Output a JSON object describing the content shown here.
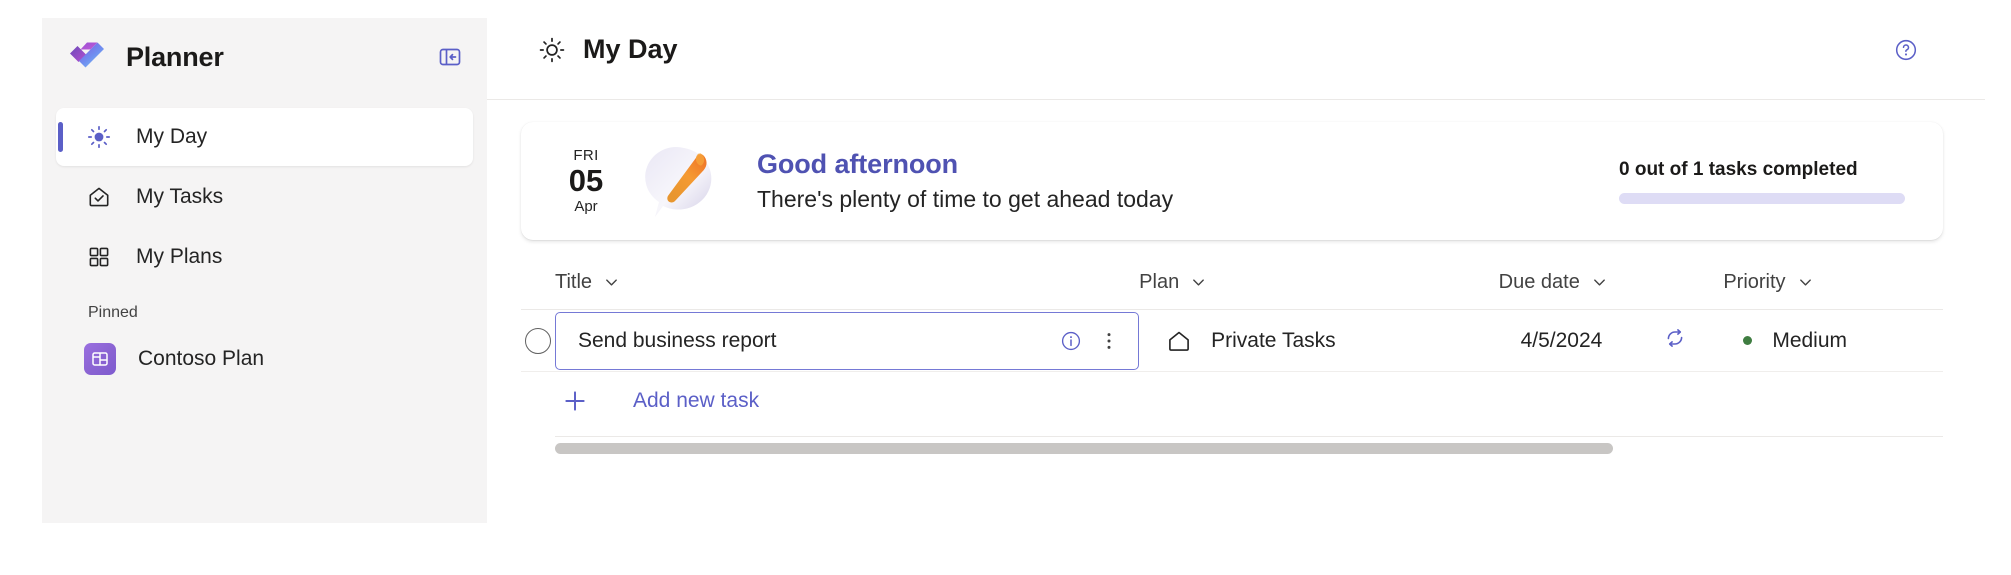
{
  "brand": {
    "name": "Planner",
    "logo_icon": "planner-logo-icon",
    "collapse_icon": "collapse-sidebar-icon"
  },
  "sidebar": {
    "items": [
      {
        "label": "My Day",
        "icon": "sun-icon",
        "active": true
      },
      {
        "label": "My Tasks",
        "icon": "home-check-icon",
        "active": false
      },
      {
        "label": "My Plans",
        "icon": "grid-icon",
        "active": false
      }
    ],
    "section_label": "Pinned",
    "pinned": [
      {
        "label": "Contoso Plan",
        "icon": "plan-board-icon"
      }
    ]
  },
  "header": {
    "icon": "sun-icon",
    "title": "My Day",
    "help_icon": "help-circle-icon"
  },
  "banner": {
    "day_of_week": "FRI",
    "day_number": "05",
    "month": "Apr",
    "illustration_icon": "pencil-bubble-illustration",
    "greeting": "Good afternoon",
    "subtitle": "There's plenty of time to get ahead today",
    "progress_label": "0 out of 1 tasks completed",
    "progress_percent": 0
  },
  "table": {
    "columns": [
      {
        "label": "Title",
        "sort_icon": "chevron-down-icon"
      },
      {
        "label": "Plan",
        "sort_icon": "chevron-down-icon"
      },
      {
        "label": "Due date",
        "sort_icon": "chevron-down-icon"
      },
      {
        "label": "Priority",
        "sort_icon": "chevron-down-icon"
      }
    ],
    "rows": [
      {
        "completed": false,
        "title": "Send business report",
        "title_placeholder": "Enter a task name",
        "info_icon": "info-circle-icon",
        "more_icon": "more-vertical-icon",
        "plan_icon": "home-icon",
        "plan": "Private Tasks",
        "due_date": "4/5/2024",
        "recurrence_icon": "repeat-icon",
        "priority": "Medium",
        "priority_color": "#3f7d41"
      }
    ],
    "add_task_label": "Add new task",
    "add_task_icon": "plus-icon"
  },
  "colors": {
    "accent": "#5b5fc7",
    "accent_dark": "#4f52b2",
    "sidebar_bg": "#f5f4f4",
    "progress_track": "#dedcf5",
    "scrollbar": "#c8c6c4"
  }
}
